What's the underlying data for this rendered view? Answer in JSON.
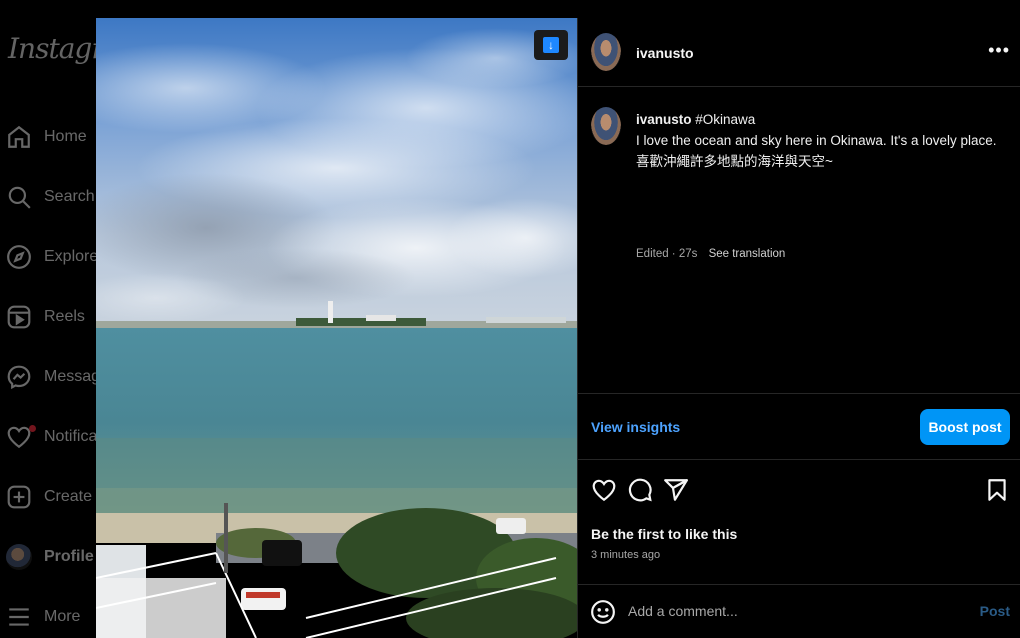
{
  "sidebar": {
    "logo": "Instagram",
    "items": [
      {
        "label": "Home",
        "icon": "home-icon"
      },
      {
        "label": "Search",
        "icon": "search-icon"
      },
      {
        "label": "Explore",
        "icon": "compass-icon"
      },
      {
        "label": "Reels",
        "icon": "reels-icon"
      },
      {
        "label": "Messages",
        "icon": "messenger-icon"
      },
      {
        "label": "Notifications",
        "icon": "heart-icon"
      },
      {
        "label": "Create",
        "icon": "plus-square-icon"
      },
      {
        "label": "Profile",
        "icon": "avatar"
      },
      {
        "label": "More",
        "icon": "menu-icon"
      }
    ]
  },
  "post": {
    "username": "ivanusto",
    "caption_user": "ivanusto",
    "hashtag": "#Okinawa",
    "caption_line1": "I love the ocean and sky here in Okinawa. It's a lovely place.",
    "caption_line2": "喜歡沖繩許多地點的海洋與天空~",
    "edited": "Edited · 27s",
    "see_translation": "See translation",
    "view_insights": "View insights",
    "boost_label": "Boost post",
    "likes_text": "Be the first to like this",
    "time_ago": "3 minutes ago",
    "comment_placeholder": "Add a comment...",
    "post_label": "Post"
  },
  "colors": {
    "accent": "#0095f6",
    "link": "#4da3ff",
    "notification": "#ff3040",
    "background": "#000000",
    "border": "#262626"
  }
}
